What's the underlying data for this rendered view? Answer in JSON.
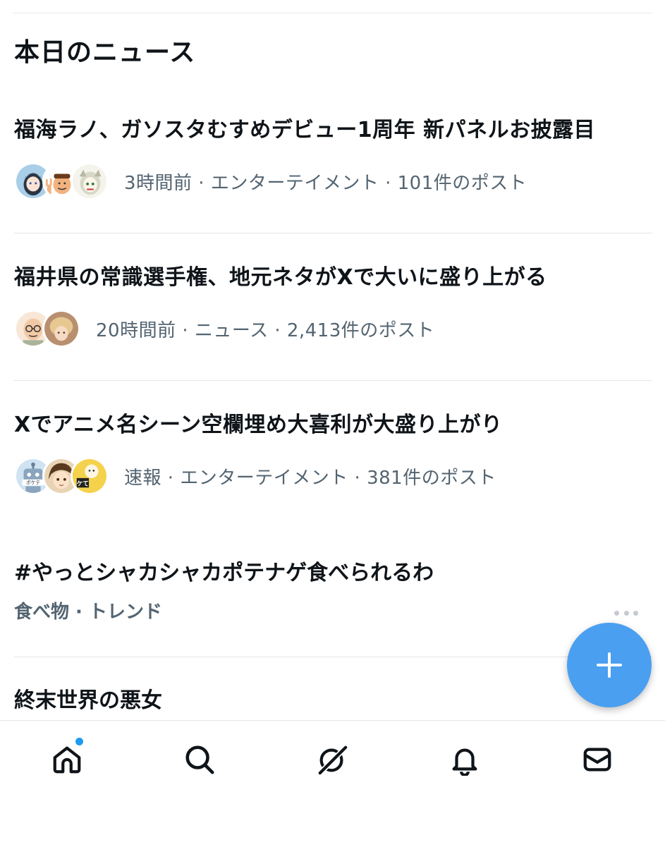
{
  "section_title": "本日のニュース",
  "news": [
    {
      "title": "福海ラノ、ガソスタむすめデビュー1周年 新パネルお披露目",
      "meta": "3時間前 · エンターテイメント · 101件のポスト",
      "avatars": [
        "avatar-anime-girl",
        "avatar-peace-sign",
        "avatar-manga-character"
      ]
    },
    {
      "title": "福井県の常識選手権、地元ネタがXで大いに盛り上がる",
      "meta": "20時間前 · ニュース · 2,413件のポスト",
      "avatars": [
        "avatar-glasses-man",
        "avatar-blonde-person"
      ]
    },
    {
      "title": "Xでアニメ名シーン空欄埋め大喜利が大盛り上がり",
      "meta": "速報 · エンターテイメント · 381件のポスト",
      "avatars": [
        "avatar-robot",
        "avatar-anime-boy",
        "avatar-cartoon"
      ],
      "robot_label": "ボケテ",
      "cartoon_label": "ケて"
    }
  ],
  "trend": {
    "title": "#やっとシャカシャカポテナゲ食べられるわ",
    "meta": "食べ物 · トレンド"
  },
  "partial_item": {
    "title": "終末世界の悪女"
  },
  "fab": {
    "icon": "plus-icon"
  },
  "nav": [
    {
      "name": "home",
      "icon": "home-icon",
      "has_badge": true
    },
    {
      "name": "search",
      "icon": "search-icon",
      "has_badge": false
    },
    {
      "name": "grok",
      "icon": "grok-icon",
      "has_badge": false
    },
    {
      "name": "notifications",
      "icon": "bell-icon",
      "has_badge": false
    },
    {
      "name": "messages",
      "icon": "mail-icon",
      "has_badge": false
    }
  ],
  "colors": {
    "accent": "#1d9bf0",
    "fab": "#4a9ff0",
    "meta_text": "#536471",
    "title_text": "#0f1419"
  }
}
